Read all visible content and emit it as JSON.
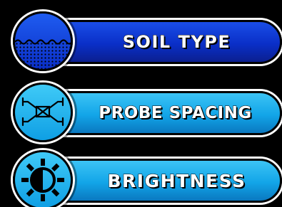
{
  "menu": {
    "items": [
      {
        "label": "SOIL TYPE",
        "icon": "soil-icon",
        "accent": "#0a2fc8"
      },
      {
        "label": "PROBE SPACING",
        "icon": "probe-spacing-icon",
        "accent": "#12a5e8"
      },
      {
        "label": "BRIGHTNESS",
        "icon": "brightness-icon",
        "accent": "#12a5e8"
      }
    ]
  }
}
